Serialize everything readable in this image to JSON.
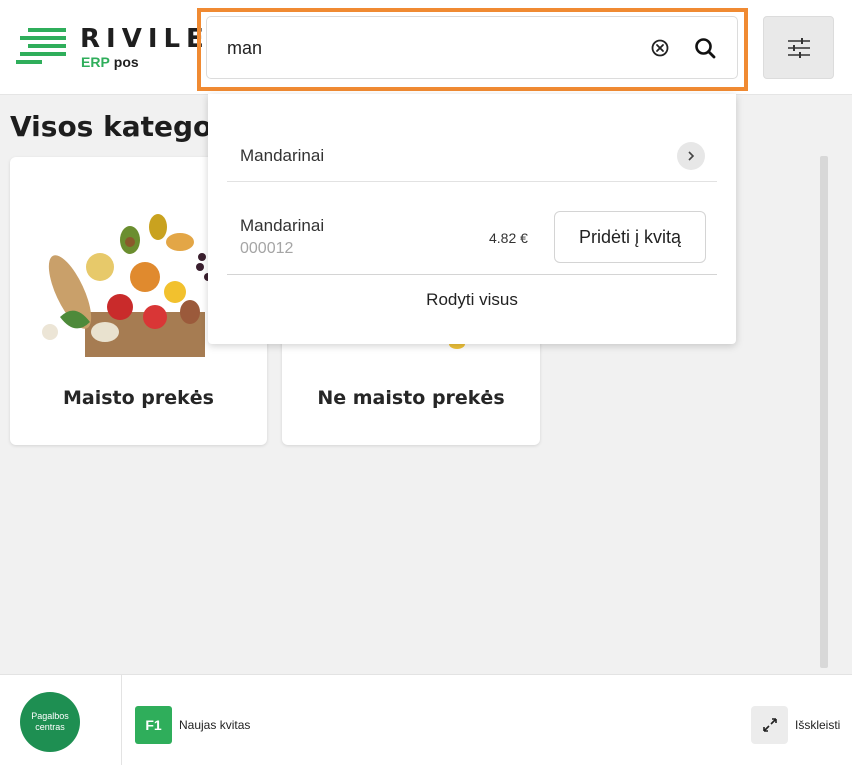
{
  "header": {
    "logo": {
      "name": "RIVILE",
      "sub_erp": "ERP",
      "sub_pos": "pos"
    },
    "search": {
      "value": "man",
      "placeholder": ""
    }
  },
  "main": {
    "title": "Visos kategorij",
    "categories": [
      {
        "label": "Maisto prekės"
      },
      {
        "label": "Ne maisto prekės"
      }
    ]
  },
  "dropdown": {
    "category": {
      "label": "Mandarinai"
    },
    "product": {
      "name": "Mandarinai",
      "code": "000012",
      "price": "4.82 €",
      "add_label": "Pridėti į kvitą"
    },
    "show_all": "Rodyti visus"
  },
  "footer": {
    "help": {
      "line1": "Pagalbos",
      "line2": "centras"
    },
    "f1": "F1",
    "new_receipt": "Naujas kvitas",
    "expand": "Išskleisti"
  },
  "colors": {
    "brand_green": "#2fae5b",
    "highlight_orange": "#f08a32"
  }
}
